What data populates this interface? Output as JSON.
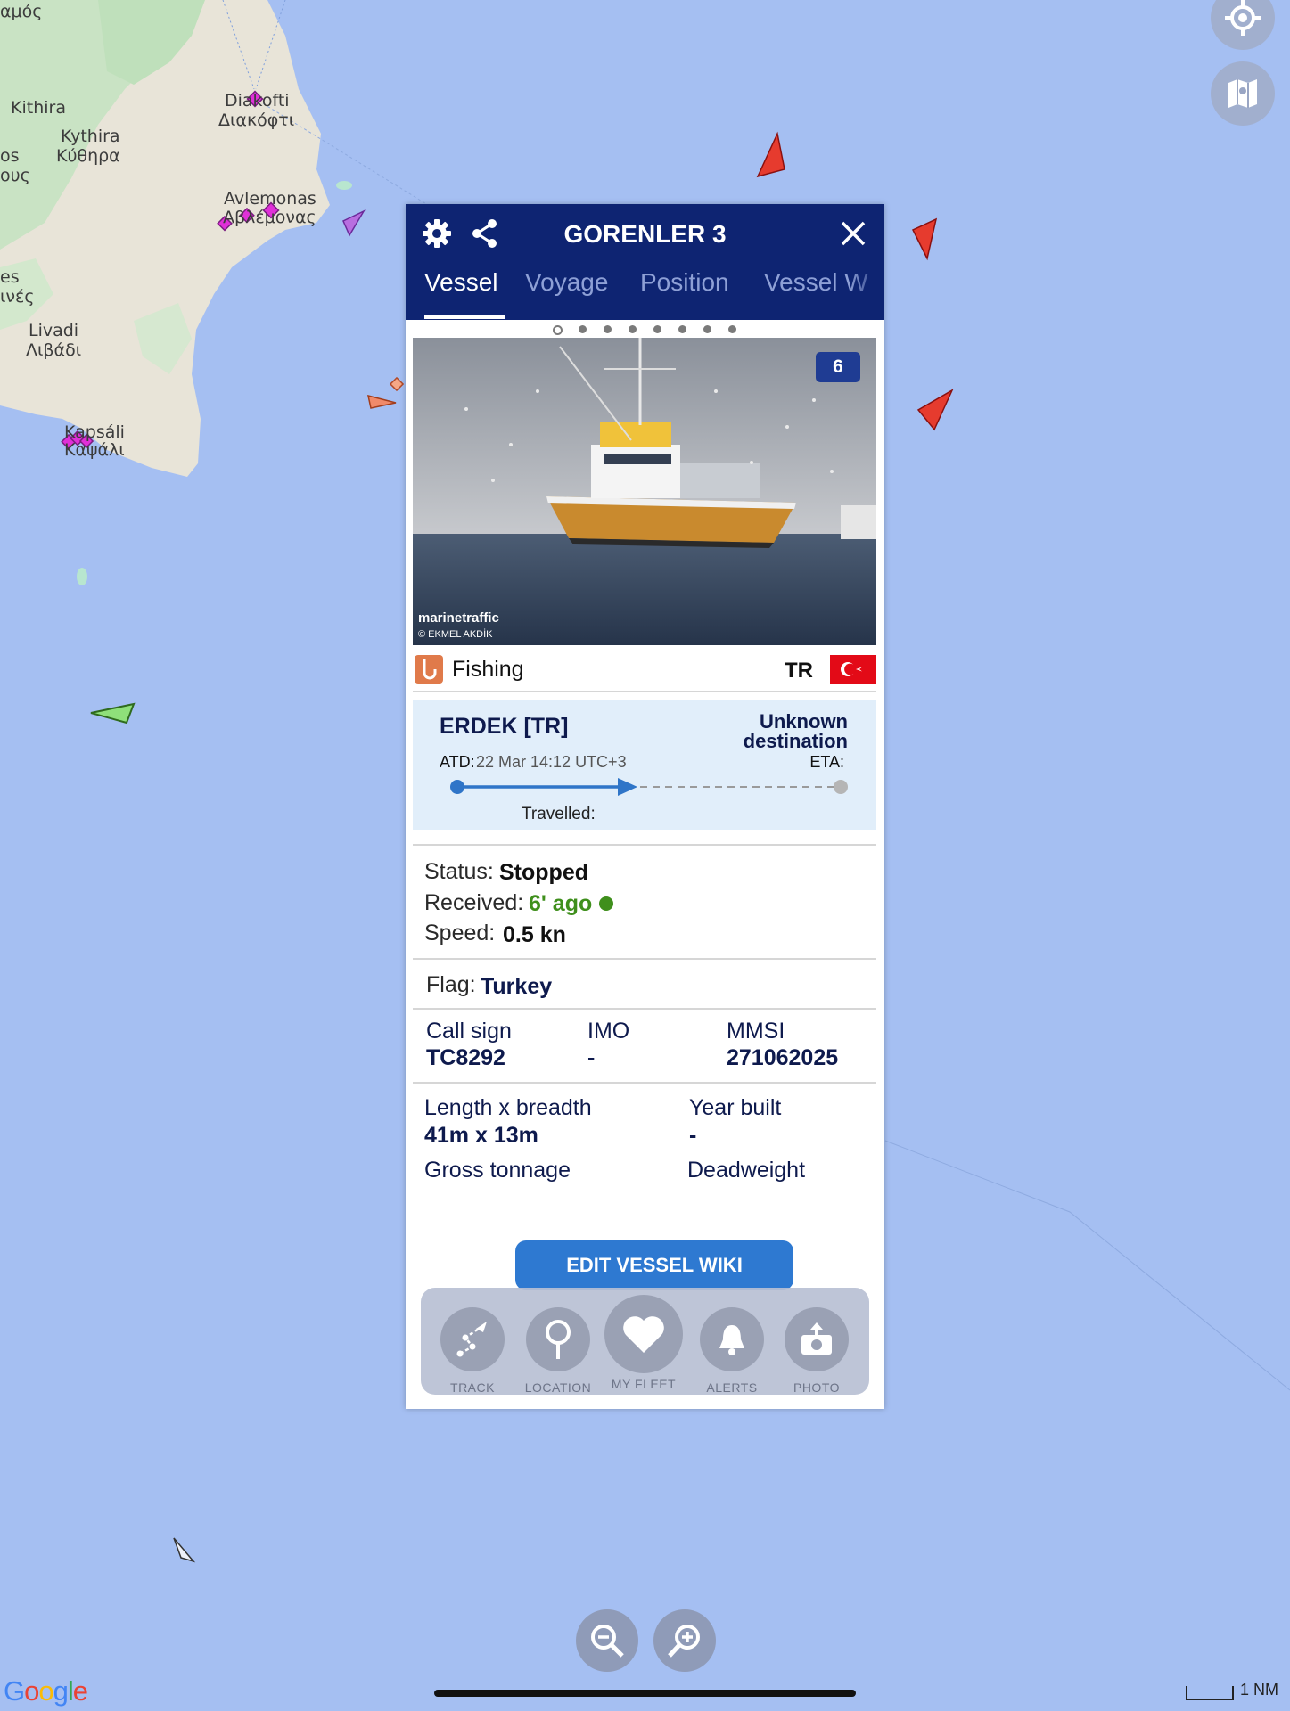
{
  "map": {
    "places": [
      {
        "key": "amos",
        "text": "αμός"
      },
      {
        "key": "kithira",
        "text": "Kithira"
      },
      {
        "key": "kythira",
        "text": "Kythira"
      },
      {
        "key": "kythira_gr",
        "text": "Κύθηρα"
      },
      {
        "key": "os",
        "text": "os"
      },
      {
        "key": "ous",
        "text": "ους"
      },
      {
        "key": "diakofti",
        "text": "Diakofti"
      },
      {
        "key": "diakofti_gr",
        "text": "Διακόφτι"
      },
      {
        "key": "avlemonas",
        "text": "Avlemonas"
      },
      {
        "key": "avlemonas_gr",
        "text": "Αβλέμονας"
      },
      {
        "key": "es",
        "text": "es"
      },
      {
        "key": "nes",
        "text": "ινές"
      },
      {
        "key": "livadi",
        "text": "Livadi"
      },
      {
        "key": "livadi_gr",
        "text": "Λιβάδι"
      },
      {
        "key": "kapsali",
        "text": "Kapsáli"
      },
      {
        "key": "kapsali_gr",
        "text": "Καψάλι"
      }
    ],
    "google_logo": "Google",
    "scale_label": "1 NM",
    "buttons": {
      "locate_icon": "crosshair-icon",
      "layers_icon": "map-layers-icon"
    },
    "zoom": {
      "out_icon": "zoom-out-icon",
      "in_icon": "zoom-in-icon"
    }
  },
  "panel": {
    "title": "GORENLER 3",
    "settings_icon": "gear-icon",
    "share_icon": "share-icon",
    "close_icon": "close-icon",
    "tabs": [
      {
        "label": "Vessel",
        "active": true
      },
      {
        "label": "Voyage",
        "active": false
      },
      {
        "label": "Position",
        "active": false
      },
      {
        "label": "Vessel W",
        "active": false
      }
    ],
    "photo": {
      "count": "6",
      "brand": "marinetraffic",
      "credit": "© EKMEL AKDİK"
    },
    "vessel_type": "Fishing",
    "flag_code": "TR",
    "voyage": {
      "origin": "ERDEK [TR]",
      "destination_line1": "Unknown",
      "destination_line2": "destination",
      "atd_label": "ATD:",
      "atd_value": "22 Mar 14:12 UTC+3",
      "eta_label": "ETA:",
      "travelled_label": "Travelled:"
    },
    "status": {
      "status_label": "Status:",
      "status_value": "Stopped",
      "received_label": "Received:",
      "received_value": "6' ago",
      "speed_label": "Speed:",
      "speed_value": "0.5 kn"
    },
    "flag": {
      "label": "Flag:",
      "value": "Turkey"
    },
    "ids": {
      "callsign_label": "Call sign",
      "callsign_value": "TC8292",
      "imo_label": "IMO",
      "imo_value": "-",
      "mmsi_label": "MMSI",
      "mmsi_value": "271062025"
    },
    "dims": {
      "lb_label": "Length x breadth",
      "lb_value": "41m x 13m",
      "year_label": "Year built",
      "year_value": "-",
      "gt_label": "Gross tonnage",
      "dw_label": "Deadweight"
    },
    "edit_button": "EDIT VESSEL WIKI",
    "actions": [
      {
        "label": "TRACK",
        "icon": "track-icon"
      },
      {
        "label": "LOCATION",
        "icon": "location-pin-icon"
      },
      {
        "label": "MY FLEET",
        "icon": "heart-icon"
      },
      {
        "label": "ALERTS",
        "icon": "bell-icon"
      },
      {
        "label": "PHOTO",
        "icon": "camera-upload-icon"
      }
    ]
  },
  "colors": {
    "header": "#0e2472",
    "accent": "#2e79d1",
    "received_green": "#3f8f1c",
    "sea": "#a5bff2"
  }
}
